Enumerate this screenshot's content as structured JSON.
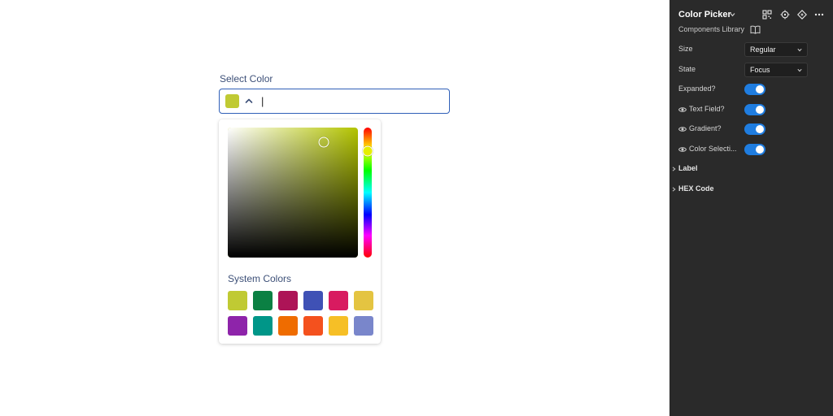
{
  "canvas": {
    "field_label": "Select Color",
    "input": {
      "value": "|",
      "swatch_color": "#c0ca33"
    },
    "picker": {
      "hue_color": "#b3c400",
      "saturation": 0.74,
      "value": 0.89,
      "hue_position": 0.18,
      "system_colors_title": "System Colors",
      "system_colors": [
        "#c0ca33",
        "#0b8043",
        "#ad1457",
        "#3f51b5",
        "#d81b60",
        "#e4c441",
        "#8e24aa",
        "#009688",
        "#ef6c00",
        "#f4511e",
        "#f6bf26",
        "#7986cb"
      ]
    }
  },
  "panel": {
    "title": "Color Picker",
    "subtitle": "Components Library",
    "header_icons": [
      "grid-icon",
      "target-icon",
      "component-icon",
      "more-icon"
    ],
    "props": {
      "size": {
        "label": "Size",
        "value": "Regular"
      },
      "state": {
        "label": "State",
        "value": "Focus"
      },
      "expanded": {
        "label": "Expanded?",
        "on": true
      },
      "text_field": {
        "label": "Text Field?",
        "on": true
      },
      "gradient": {
        "label": "Gradient?",
        "on": true
      },
      "color_selection": {
        "label": "Color Selecti...",
        "on": true
      }
    },
    "sections": {
      "label": "Label",
      "hex_code": "HEX Code"
    },
    "accent_color": "#1f7de0",
    "background_color": "#2a2a2a"
  }
}
